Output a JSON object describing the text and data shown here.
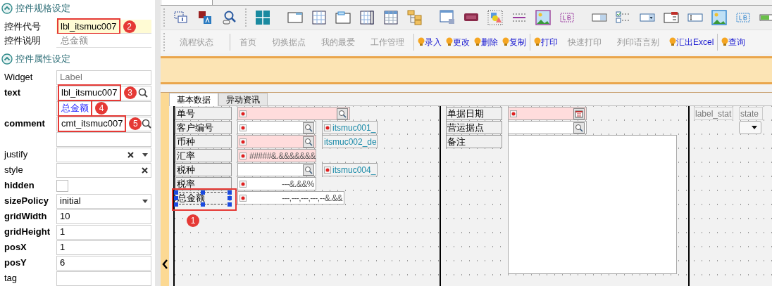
{
  "sections": [
    {
      "title": "控件规格设定",
      "expanded": true
    },
    {
      "title": "控件属性设定",
      "expanded": true
    }
  ],
  "spec": [
    {
      "label": "控件代号",
      "value": "lbl_itsmuc007",
      "highlighted": true,
      "callout": "2"
    },
    {
      "label": "控件说明",
      "value": "总金额",
      "highlighted": false
    }
  ],
  "properties": [
    {
      "name": "Widget",
      "modified": false,
      "kind": "readonly",
      "value": "Label"
    },
    {
      "name": "text",
      "modified": true,
      "kind": "lookup",
      "value": "lbl_itsmuc007",
      "callout": "3"
    },
    {
      "kind": "translation",
      "value": "总金额",
      "callout": "4"
    },
    {
      "name": "comment",
      "modified": true,
      "kind": "lookup",
      "value": "cmt_itsmuc007",
      "callout": "5"
    },
    {
      "kind": "blank"
    },
    {
      "name": "justify",
      "modified": false,
      "kind": "combo-clear"
    },
    {
      "name": "style",
      "modified": false,
      "kind": "clear"
    },
    {
      "name": "hidden",
      "modified": true,
      "kind": "checkbox",
      "checked": false
    },
    {
      "name": "sizePolicy",
      "modified": true,
      "kind": "dropdown",
      "value": "initial"
    },
    {
      "name": "gridWidth",
      "modified": true,
      "kind": "text",
      "value": "10"
    },
    {
      "name": "gridHeight",
      "modified": true,
      "kind": "text",
      "value": "1"
    },
    {
      "name": "posX",
      "modified": true,
      "kind": "text",
      "value": "1"
    },
    {
      "name": "posY",
      "modified": true,
      "kind": "text",
      "value": "6"
    },
    {
      "name": "tag",
      "modified": false,
      "kind": "text"
    }
  ],
  "action_bar": [
    {
      "buttons": [
        {
          "label": "流程状态",
          "disabled": true
        }
      ]
    },
    {
      "buttons": [
        {
          "label": "首页",
          "disabled": true
        },
        {
          "label": "切换据点",
          "disabled": true
        },
        {
          "label": "我的最爱",
          "disabled": true
        },
        {
          "label": "工作管理",
          "disabled": true
        }
      ]
    },
    {
      "buttons": [
        {
          "label": "录入",
          "disabled": false
        },
        {
          "label": "更改",
          "disabled": false
        },
        {
          "label": "删除",
          "disabled": false
        },
        {
          "label": "复制",
          "disabled": false
        }
      ]
    },
    {
      "buttons": [
        {
          "label": "打印",
          "disabled": false
        },
        {
          "label": "快速打印",
          "disabled": true
        },
        {
          "label": "列印语言别",
          "disabled": true
        },
        {
          "label": "汇出Excel",
          "disabled": false
        }
      ]
    },
    {
      "buttons": [
        {
          "label": "查询",
          "disabled": false
        }
      ]
    }
  ],
  "form": {
    "tabs": [
      {
        "label": "基本数据",
        "selected": true
      },
      {
        "label": "异动资讯",
        "selected": false
      }
    ],
    "left": [
      {
        "label": "单号",
        "field": {
          "required": true,
          "marker": true,
          "kind": "lookup"
        }
      },
      {
        "label": "客户编号",
        "field": {
          "required": false,
          "marker": true,
          "kind": "lookup"
        },
        "description": {
          "text": "itsmuc001_",
          "marker": true
        }
      },
      {
        "label": "币种",
        "field": {
          "required": true,
          "marker": true,
          "kind": "lookup"
        },
        "description": {
          "text": "itsmuc002_de",
          "marker": false
        }
      },
      {
        "label": "汇率",
        "field": {
          "required": true,
          "marker": true,
          "kind": "number",
          "value": "#####&.&&&&&&&"
        }
      },
      {
        "label": "税种",
        "field": {
          "required": false,
          "marker": false,
          "kind": "lookup"
        },
        "description": {
          "text": "itsmuc004_",
          "marker": true
        }
      },
      {
        "label": "税率",
        "field": {
          "required": false,
          "marker": true,
          "kind": "number",
          "value": "---&.&&%"
        }
      },
      {
        "label": "总金额",
        "selected": true,
        "callout": "1",
        "field": {
          "required": false,
          "marker": true,
          "kind": "number",
          "value": "---,---,---,---,--&.&&"
        }
      }
    ],
    "right": [
      {
        "label": "单据日期",
        "field": {
          "required": true,
          "marker": true,
          "kind": "date"
        }
      },
      {
        "label": "营运据点",
        "field": {
          "required": false,
          "marker": false,
          "kind": "lookup"
        }
      },
      {
        "label": "备注",
        "field": {
          "required": false,
          "marker": false,
          "kind": "textarea"
        }
      }
    ],
    "extra": [
      {
        "kind": "label",
        "text": "label_stat"
      },
      {
        "kind": "label",
        "text": "state"
      },
      {
        "kind": "combo"
      }
    ]
  }
}
